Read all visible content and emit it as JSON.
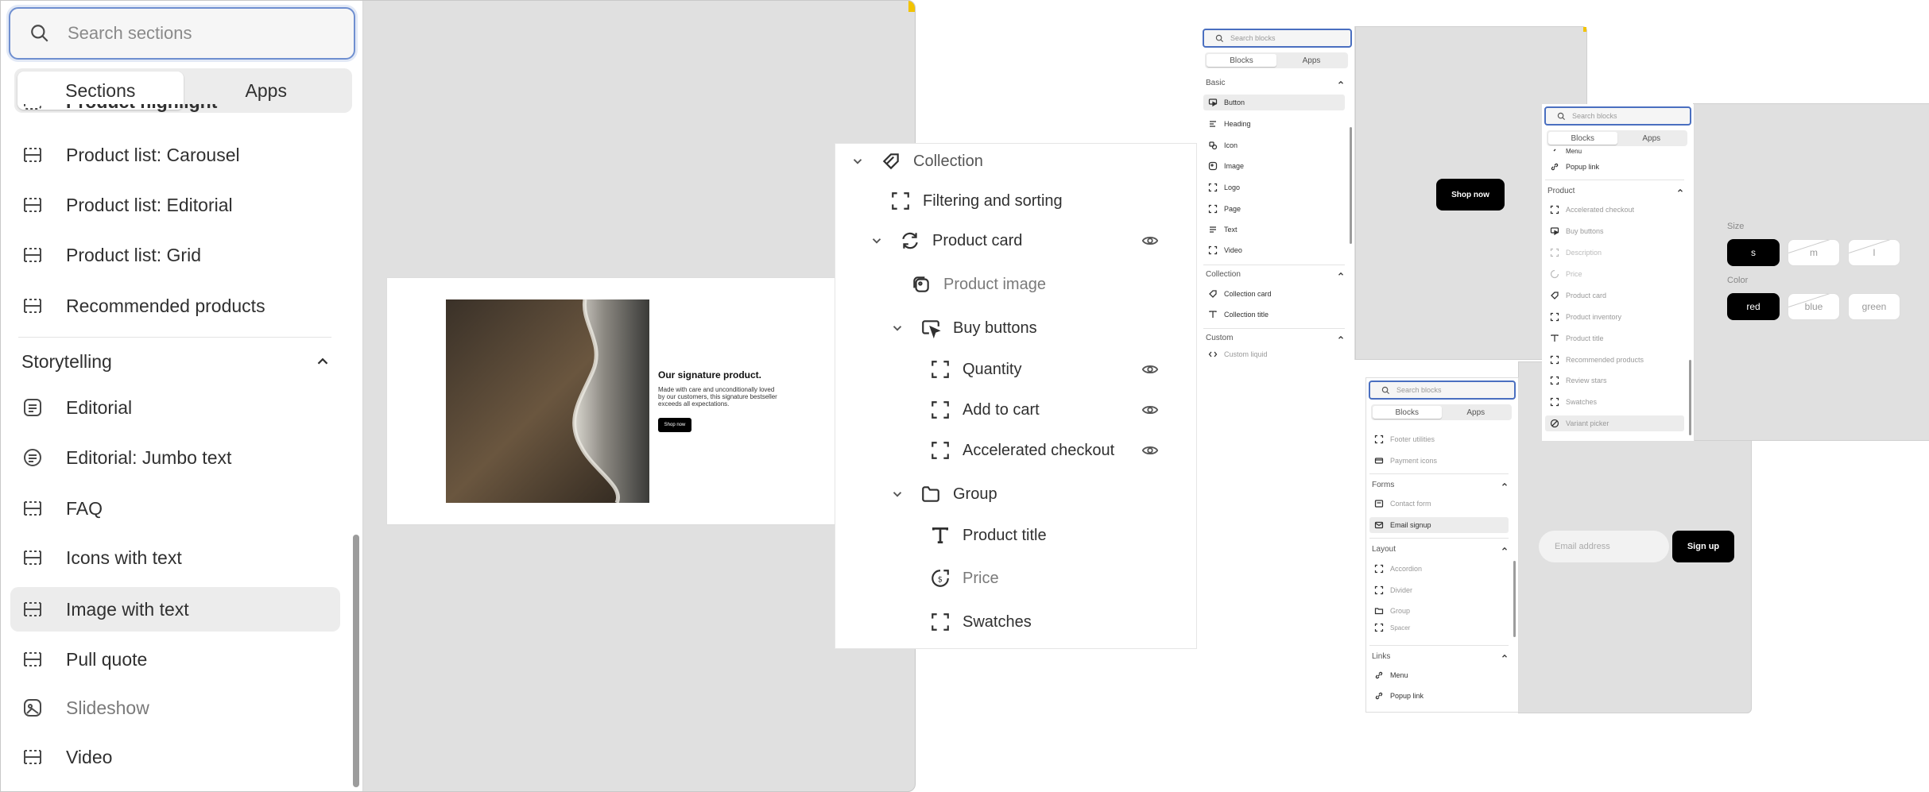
{
  "big": {
    "search_placeholder": "Search sections",
    "tabs": [
      "Sections",
      "Apps"
    ],
    "partial_item": "Product highlight",
    "items": [
      {
        "label": "Product list: Carousel"
      },
      {
        "label": "Product list: Editorial"
      },
      {
        "label": "Product list: Grid"
      },
      {
        "label": "Recommended products"
      }
    ],
    "category": "Storytelling",
    "story_items": [
      {
        "label": "Editorial"
      },
      {
        "label": "Editorial: Jumbo text"
      },
      {
        "label": "FAQ"
      },
      {
        "label": "Icons with text"
      },
      {
        "label": "Image with text"
      },
      {
        "label": "Pull quote"
      },
      {
        "label": "Slideshow"
      },
      {
        "label": "Video"
      }
    ],
    "preview": {
      "heading": "Our signature product.",
      "body": "Made with care and unconditionally loved by our customers, this signature bestseller exceeds all expectations.",
      "button": "Shop now"
    }
  },
  "tree": {
    "nodes": [
      {
        "label": "Collection"
      },
      {
        "label": "Filtering and sorting"
      },
      {
        "label": "Product card"
      },
      {
        "label": "Product image"
      },
      {
        "label": "Buy buttons"
      },
      {
        "label": "Quantity"
      },
      {
        "label": "Add to cart"
      },
      {
        "label": "Accelerated checkout"
      },
      {
        "label": "Group"
      },
      {
        "label": "Product title"
      },
      {
        "label": "Price"
      },
      {
        "label": "Swatches"
      }
    ]
  },
  "p1": {
    "search_placeholder": "Search blocks",
    "tabs": [
      "Blocks",
      "Apps"
    ],
    "cat_basic": "Basic",
    "basic_items": [
      "Button",
      "Heading",
      "Icon",
      "Image",
      "Logo",
      "Page",
      "Text",
      "Video"
    ],
    "cat_collection": "Collection",
    "collection_items": [
      "Collection card",
      "Collection title"
    ],
    "cat_custom": "Custom",
    "custom_items": [
      "Custom liquid"
    ],
    "button": "Shop now"
  },
  "p2": {
    "search_placeholder": "Search blocks",
    "tabs": [
      "Blocks",
      "Apps"
    ],
    "partial_top": "Menu",
    "top_items": [
      "Popup link"
    ],
    "cat_product": "Product",
    "product_items": [
      "Accelerated checkout",
      "Buy buttons",
      "Description",
      "Price",
      "Product card",
      "Product inventory",
      "Product title",
      "Recommended products",
      "Review stars",
      "Swatches",
      "Variant picker"
    ],
    "size_label": "Size",
    "sizes": [
      "s",
      "m",
      "l"
    ],
    "color_label": "Color",
    "colors": [
      "red",
      "blue",
      "green"
    ]
  },
  "p3": {
    "search_placeholder": "Search blocks",
    "tabs": [
      "Blocks",
      "Apps"
    ],
    "top_items": [
      "Footer utilities",
      "Payment icons"
    ],
    "cat_forms": "Forms",
    "forms_items": [
      "Contact form",
      "Email signup"
    ],
    "cat_layout": "Layout",
    "layout_items": [
      "Accordion",
      "Divider",
      "Group",
      "Spacer"
    ],
    "cat_links": "Links",
    "links_items": [
      "Menu",
      "Popup link"
    ],
    "email_placeholder": "Email address",
    "signup": "Sign up"
  }
}
